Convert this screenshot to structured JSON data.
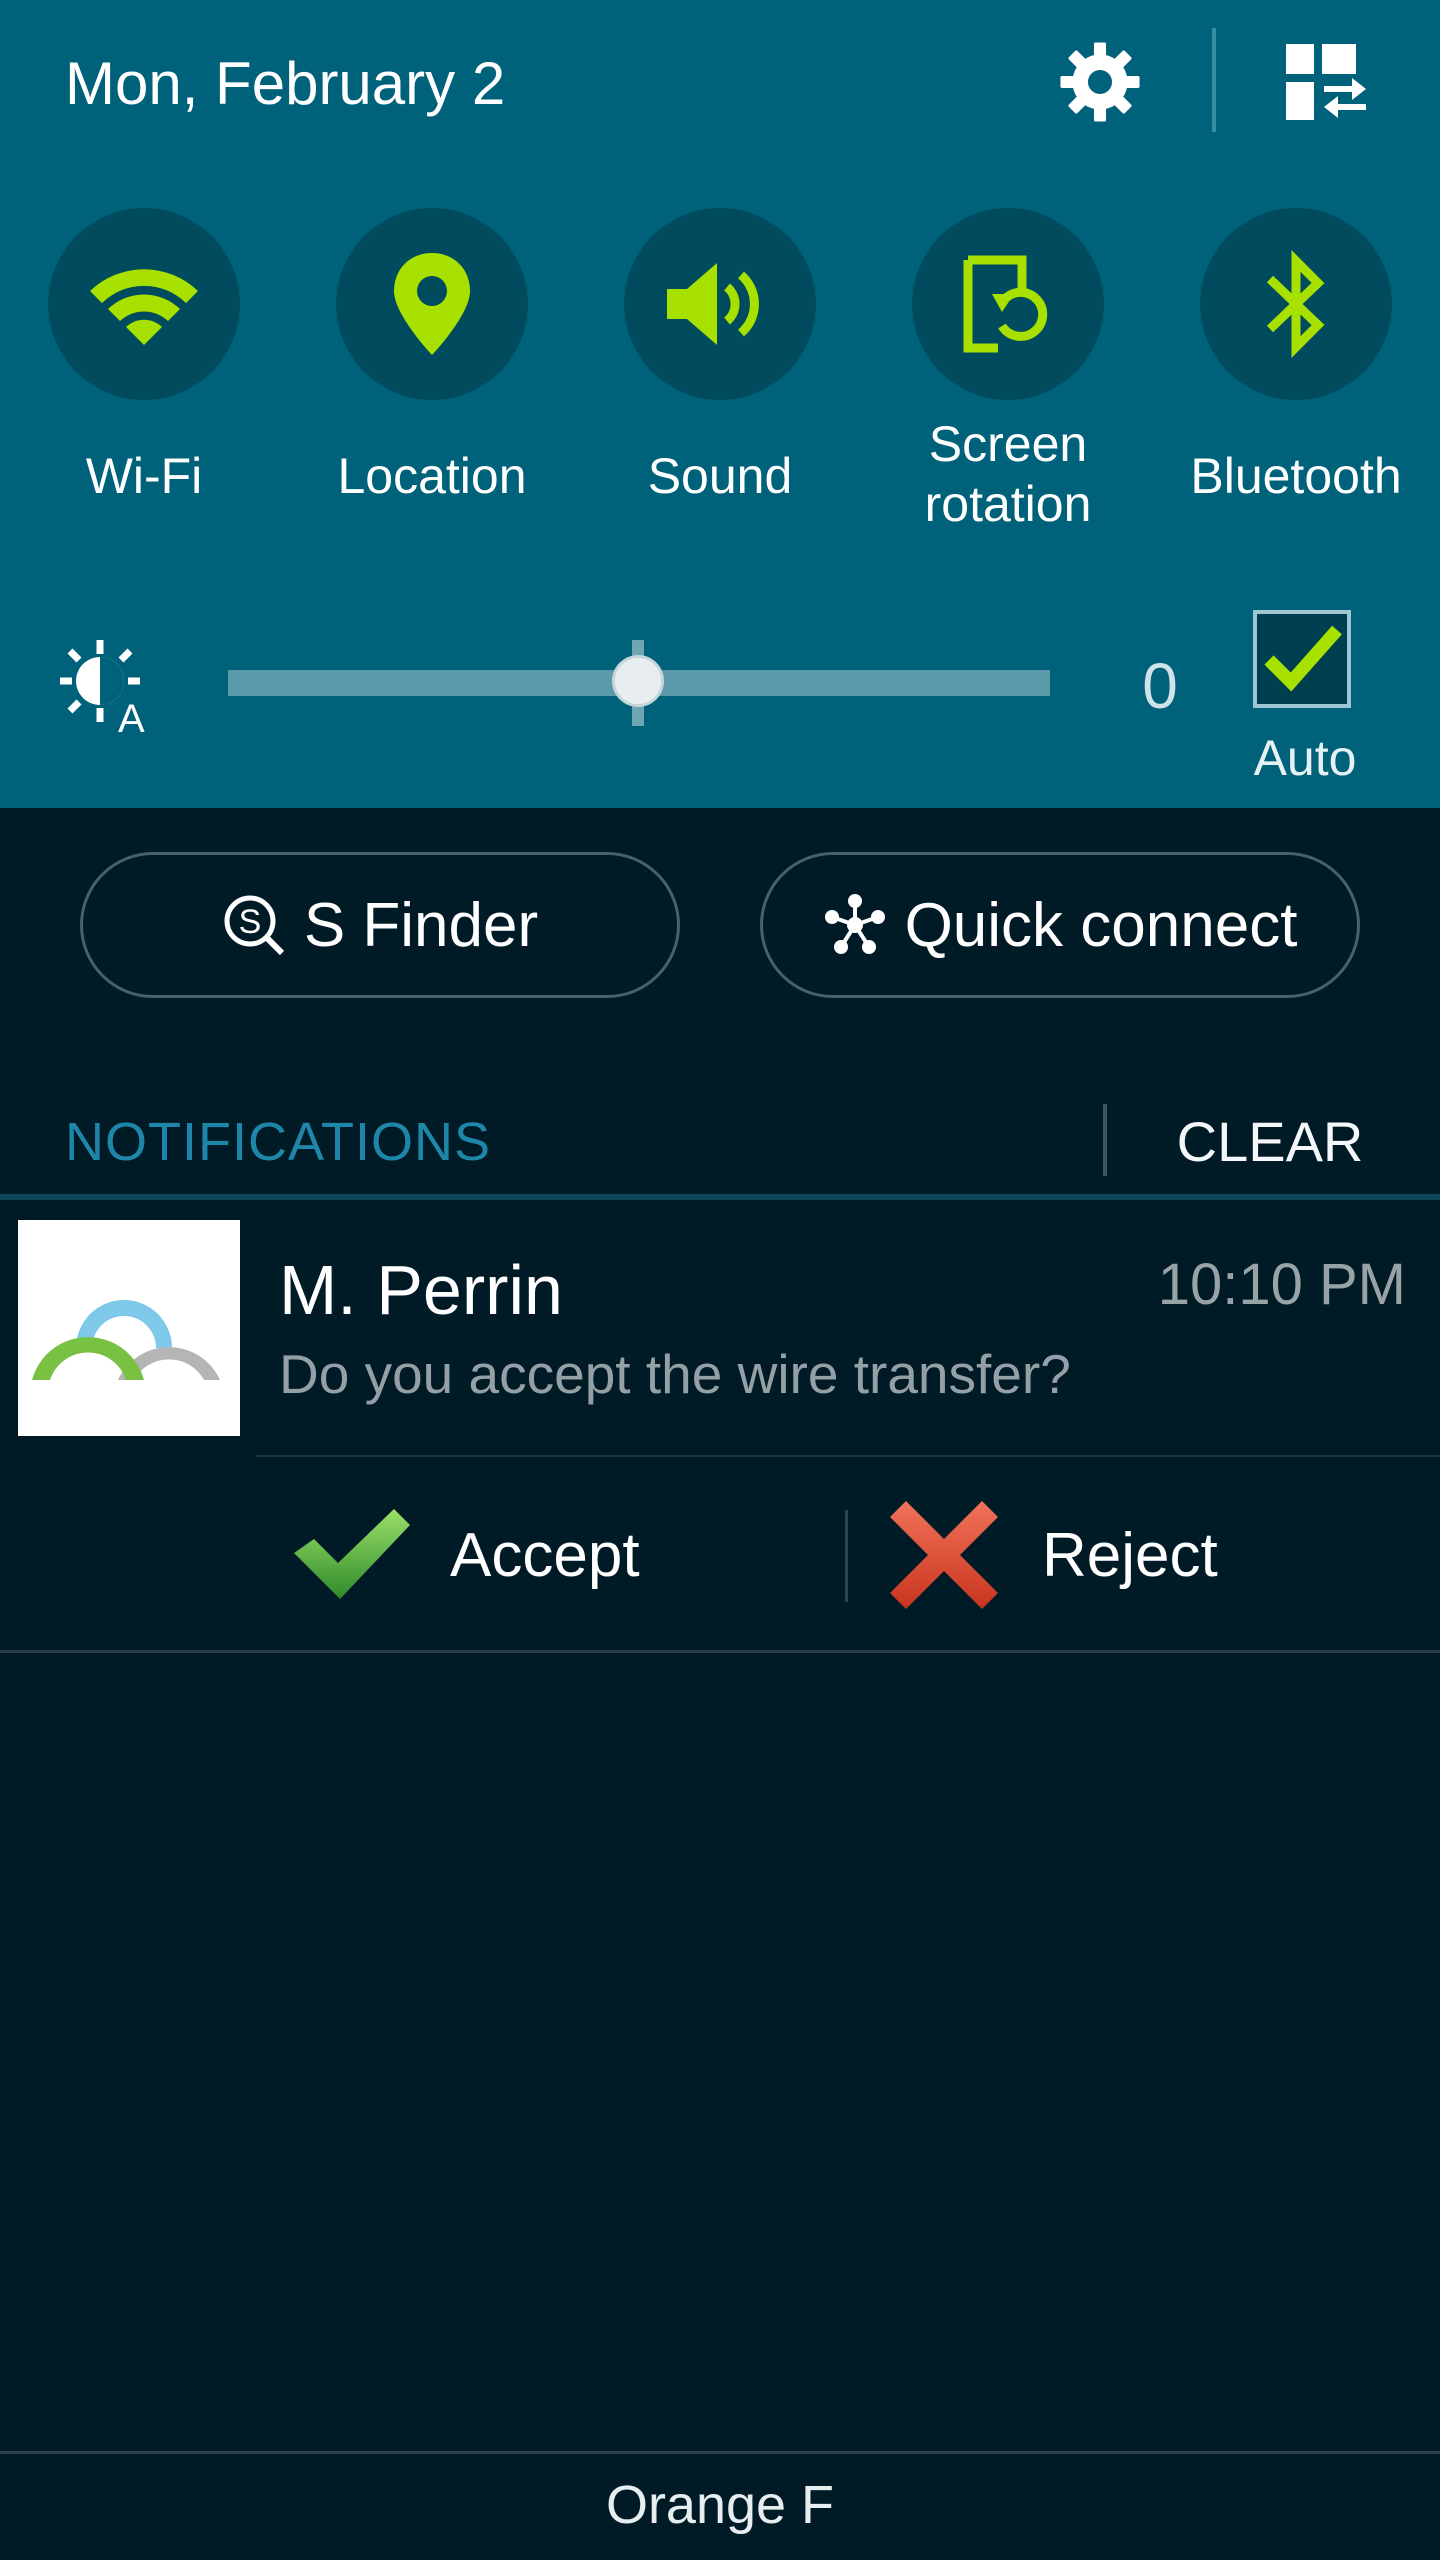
{
  "header": {
    "date": "Mon, February 2",
    "settings_icon": "gear-icon",
    "grid_icon": "quick-panel-edit-icon"
  },
  "colors": {
    "panel_bg": "#00627a",
    "toggle_accent": "#a8e000",
    "page_bg": "#001a26",
    "notifications_label": "#1e86a8",
    "reject_red": "#e4503c",
    "accept_green": "#5cb83a"
  },
  "quick_toggles": [
    {
      "label": "Wi-Fi",
      "icon": "wifi-icon",
      "active": true
    },
    {
      "label": "Location",
      "icon": "location-pin-icon",
      "active": true
    },
    {
      "label": "Sound",
      "icon": "speaker-icon",
      "active": true
    },
    {
      "label": "Screen",
      "label2": "rotation",
      "icon": "screen-rotation-icon",
      "active": true
    },
    {
      "label": "Bluetooth",
      "icon": "bluetooth-icon",
      "active": true
    }
  ],
  "brightness": {
    "icon": "auto-brightness-icon",
    "value_label": "0",
    "level": 0.5,
    "auto_label": "Auto",
    "auto_checked": true
  },
  "shortcuts": {
    "s_finder": "S Finder",
    "quick_connect": "Quick connect"
  },
  "notifications": {
    "header": "NOTIFICATIONS",
    "clear": "CLEAR",
    "items": [
      {
        "title": "M. Perrin",
        "time": "10:10 PM",
        "text": "Do you accept the wire transfer?",
        "icon": "app-arches-icon",
        "actions": [
          {
            "label": "Accept",
            "icon": "green-check-icon"
          },
          {
            "label": "Reject",
            "icon": "red-x-icon"
          }
        ]
      }
    ]
  },
  "footer": {
    "carrier": "Orange F"
  }
}
